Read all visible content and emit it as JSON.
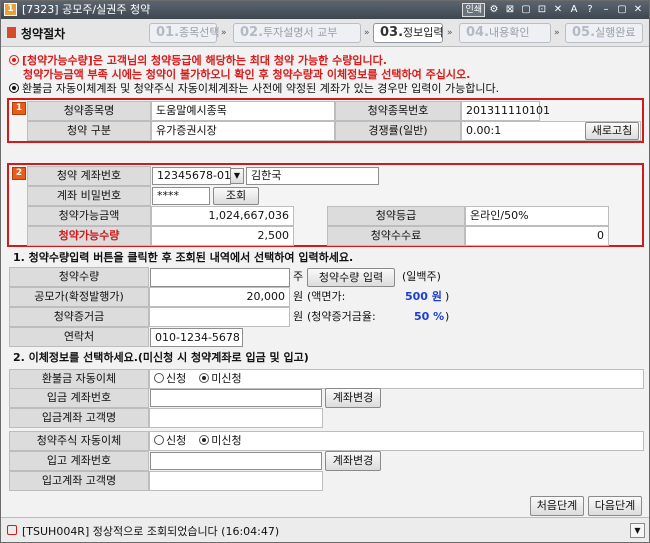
{
  "window": {
    "title": "[7323] 공모주/실권주 청약",
    "icon_glyph": "1",
    "buttons": [
      "인쇄",
      "⚙",
      "⊠",
      "▢",
      "⊡",
      "✕",
      "A",
      "?",
      "–",
      "▢",
      "✕"
    ]
  },
  "header": {
    "page_title": "청약절차",
    "steps": [
      {
        "num": "01.",
        "label": "종목선택"
      },
      {
        "num": "02.",
        "label": "투자설명서 교부"
      },
      {
        "num": "03.",
        "label": "정보입력"
      },
      {
        "num": "04.",
        "label": "내용확인"
      },
      {
        "num": "05.",
        "label": "실행완료"
      }
    ],
    "arrow": "»"
  },
  "notices": {
    "line1": "[청약가능수량]은 고객님의 청약등급에 해당하는 최대 청약 가능한 수량입니다.",
    "line2": "청약가능금액 부족 시에는 청약이 불가하오니 확인 후 청약수량과 이체정보를 선택하여 주십시오.",
    "line3": "환불금 자동이체계좌 및 청약주식 자동이체계좌는 사전에 약정된 계좌가 있는 경우만 입력이 가능합니다."
  },
  "section1": {
    "badge": "1",
    "stock_name_label": "청약종목명",
    "stock_name": "도움말예시종목",
    "stock_code_label": "청약종목번호",
    "stock_code": "201311110101",
    "type_label": "청약 구분",
    "type_value": "유가증권시장",
    "competition_label": "경쟁률(일반)",
    "competition_value": "0.00:1",
    "refresh_button": "새로고침"
  },
  "section2": {
    "badge": "2",
    "account_label": "청약 계좌번호",
    "account_number": "12345678-01",
    "account_holder": "김한국",
    "password_label": "계좌 비밀번호",
    "password_value": "****",
    "inquiry_button": "조회",
    "avail_amount_label": "청약가능금액",
    "avail_amount": "1,024,667,036",
    "grade_label": "청약등급",
    "grade_value": "온라인/50%",
    "avail_qty_label": "청약가능수량",
    "avail_qty": "2,500",
    "fee_label": "청약수수료",
    "fee_value": "0"
  },
  "section3": {
    "heading": "1. 청약수량입력 버튼을 클릭한 후 조회된 내역에서 선택하여 입력하세요.",
    "qty_label": "청약수량",
    "qty_value": "",
    "qty_unit": "주",
    "qty_button": "청약수량 입력",
    "qty_note": "(일백주)",
    "price_label": "공모가(확정발행가)",
    "price_value": "20,000",
    "price_unit": "원",
    "face_value_label": "(액면가:",
    "face_value": "500 원",
    "face_value_close": ")",
    "deposit_label": "청약증거금",
    "deposit_value": "",
    "deposit_unit": "원",
    "deposit_rate_label": "(청약증거금율:",
    "deposit_rate": "50 %",
    "deposit_rate_close": ")",
    "contact_label": "연락처",
    "contact_value": "010-1234-5678"
  },
  "section4": {
    "heading": "2. 이체정보를 선택하세요.(미신청 시 청약계좌로 입금 및 입고)",
    "refund_label": "환불금 자동이체",
    "opt_apply": "신청",
    "opt_not_apply": "미신청",
    "deposit_account_label": "입금 계좌번호",
    "deposit_holder_label": "입금계좌 고객명",
    "change_account_button": "계좌변경",
    "stock_transfer_label": "청약주식 자동이체",
    "receive_account_label": "입고 계좌번호",
    "receive_holder_label": "입고계좌 고객명"
  },
  "footer": {
    "first_button": "처음단계",
    "next_button": "다음단계"
  },
  "status": {
    "message": "[TSUH004R] 정상적으로 조회되었습니다 (16:04:47)"
  },
  "colors": {
    "accent_red": "#d11b1b",
    "badge_orange": "#e95c1a",
    "value_blue": "#1a3fd1"
  }
}
